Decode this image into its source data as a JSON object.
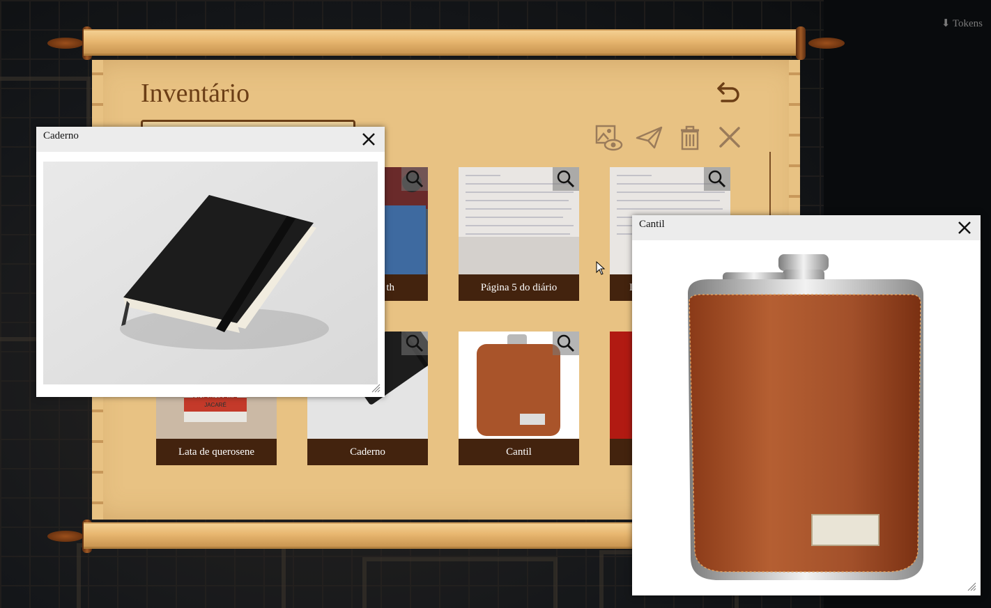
{
  "header": {
    "tokens_link": "⬇ Tokens"
  },
  "inventory": {
    "title": "Inventário",
    "toolbar": {
      "back": "undo-arrow-icon",
      "reveal": "image-eye-icon",
      "send": "paper-plane-icon",
      "delete": "trash-icon",
      "close": "close-icon"
    },
    "items": [
      {
        "label": "th"
      },
      {
        "label": "Página 5 do diário"
      },
      {
        "label": "I"
      },
      {
        "label": "Lata de querosene"
      },
      {
        "label": "Caderno"
      },
      {
        "label": "Cantil"
      },
      {
        "label": ""
      }
    ]
  },
  "popups": {
    "caderno": {
      "title": "Caderno"
    },
    "cantil": {
      "title": "Cantil"
    }
  },
  "images": {
    "kerosene_can_text": [
      "QUEROSENE",
      "JACARÉ"
    ]
  },
  "colors": {
    "parchment": "#e8c283",
    "ink": "#6b3e16",
    "label_bar": "#43230e"
  }
}
